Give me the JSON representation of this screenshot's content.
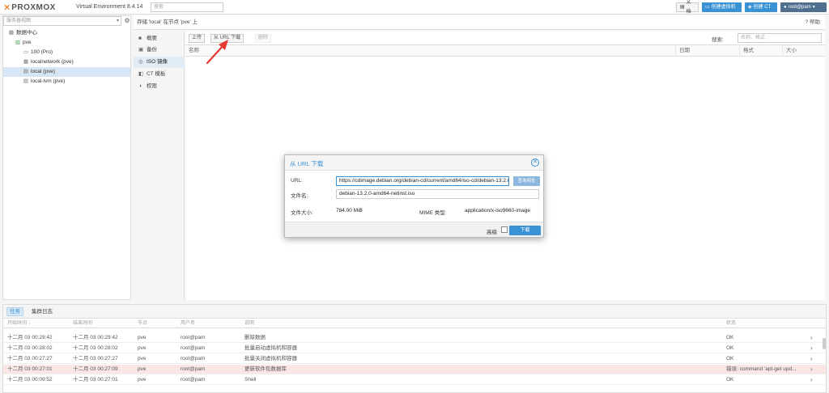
{
  "topbar": {
    "logo": "PROXMOX",
    "version": "Virtual Environment 8.4.14",
    "search_placeholder": "搜索",
    "doc_label": "文档",
    "create_vm_label": "创建虚拟机",
    "create_ct_label": "创建 CT",
    "user_label": "root@pam"
  },
  "sidebar": {
    "view_label": "服务器视图",
    "tree": [
      {
        "label": "数据中心",
        "icon": "datacenter-icon"
      },
      {
        "label": "pve",
        "icon": "node-icon"
      },
      {
        "label": "100 (Pro)",
        "icon": "vm-icon"
      },
      {
        "label": "localnetwork (pve)",
        "icon": "network-icon"
      },
      {
        "label": "local (pve)",
        "icon": "storage-icon",
        "selected": true
      },
      {
        "label": "local-lvm (pve)",
        "icon": "storage-icon"
      }
    ]
  },
  "breadcrumb": "存储 'local' 在节点 'pve' 上",
  "help_label": "帮助",
  "nav": [
    {
      "label": "概要"
    },
    {
      "label": "备份"
    },
    {
      "label": "ISO 镜像",
      "selected": true
    },
    {
      "label": "CT 模板"
    },
    {
      "label": "权限"
    }
  ],
  "toolbar": {
    "upload": "上传",
    "download_url": "从 URL 下载",
    "delete": "删除",
    "search_label": "搜索:",
    "search_placeholder": "名称、格式"
  },
  "table_headers": [
    "名称",
    "日期",
    "格式",
    "大小"
  ],
  "dialog": {
    "title": "从 URL 下载",
    "url_label": "URL:",
    "url_value": "https://cdimage.debian.org/debian-cd/current/amd64/iso-cd/debian-13.2.0-amd64-netinst.iso",
    "query_button": "查询网址",
    "filename_label": "文件名:",
    "filename_value": "debian-13.2.0-amd64-netinst.iso",
    "size_label": "文件大小:",
    "size_value": "784.00 MiB",
    "mime_label": "MIME 类型:",
    "mime_value": "application/x-iso9660-image",
    "advanced_label": "高级",
    "download_button": "下载"
  },
  "bottom": {
    "tabs": [
      "任务",
      "集群日志"
    ],
    "headers": [
      "开始时间 ↓",
      "结束时间",
      "节点",
      "用户名",
      "说明",
      "状态"
    ],
    "rows": [
      {
        "start": "十二月 03 00:29:42",
        "end": "十二月 03 00:29:42",
        "node": "pve",
        "user": "root@pam",
        "desc": "删除数据",
        "status": "OK",
        "error": false
      },
      {
        "start": "十二月 03 00:28:02",
        "end": "十二月 03 00:28:02",
        "node": "pve",
        "user": "root@pam",
        "desc": "批量启动虚拟机和容器",
        "status": "OK",
        "error": false
      },
      {
        "start": "十二月 03 00:27:27",
        "end": "十二月 03 00:27:27",
        "node": "pve",
        "user": "root@pam",
        "desc": "批量关闭虚拟机和容器",
        "status": "OK",
        "error": false
      },
      {
        "start": "十二月 03 00:27:01",
        "end": "十二月 03 00:27:09",
        "node": "pve",
        "user": "root@pam",
        "desc": "更新软件包数据库",
        "status": "错误: command 'apt-get upd...",
        "error": true
      },
      {
        "start": "十二月 03 00:09:52",
        "end": "十二月 03 00:27:01",
        "node": "pve",
        "user": "root@pam",
        "desc": "Shell",
        "status": "OK",
        "error": false
      }
    ]
  },
  "colors": {
    "accent": "#3892d4",
    "logo_orange": "#e57000",
    "annotation_arrow": "#e53935",
    "error_row": "#fbe6e6"
  }
}
